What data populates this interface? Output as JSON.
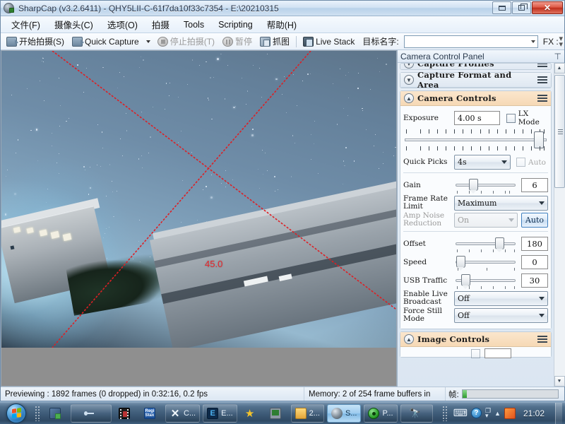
{
  "window": {
    "title": "SharpCap (v3.2.6411) - QHY5LII-C-61f7da10f33c7354 - E:\\20210315",
    "app_icon": "sharpcap-camera-icon",
    "buttons": {
      "minimize": "minimize-icon",
      "restore": "restore-icon",
      "close": "✕"
    }
  },
  "menubar": {
    "items": [
      {
        "label": "文件(F)",
        "name": "menu-file"
      },
      {
        "label": "摄像头(C)",
        "name": "menu-camera"
      },
      {
        "label": "选项(O)",
        "name": "menu-options"
      },
      {
        "label": "拍摄",
        "name": "menu-capture"
      },
      {
        "label": "Tools",
        "name": "menu-tools"
      },
      {
        "label": "Scripting",
        "name": "menu-scripting"
      },
      {
        "label": "帮助(H)",
        "name": "menu-help"
      }
    ]
  },
  "toolbar": {
    "start_capture": "开始拍摄(S)",
    "quick_capture": "Quick Capture",
    "stop_capture": "停止拍摄(T)",
    "pause": "暂停",
    "snapshot": "抓图",
    "live_stack": "Live Stack",
    "target_name_label": "目标名字:",
    "target_name_value": "",
    "target_name_placeholder": "",
    "fx_label": "FX :"
  },
  "preview": {
    "angle_overlay": "45.0",
    "overlay_color": "#e8252a",
    "description": "night-sky-camera-preview"
  },
  "camera_panel": {
    "title": "Camera Control Panel",
    "pin_icon": "pin-icon",
    "sections": [
      {
        "name": "capture-profiles",
        "title": "Capture Profiles",
        "expanded": false
      },
      {
        "name": "capture-format-and-area",
        "title": "Capture Format and Area",
        "expanded": false
      },
      {
        "name": "camera-controls",
        "title": "Camera Controls",
        "expanded": true
      },
      {
        "name": "image-controls",
        "title": "Image Controls",
        "expanded": true
      }
    ],
    "camera_controls": {
      "exposure": {
        "label": "Exposure",
        "value": "4.00 s",
        "lx_mode_label": "LX Mode",
        "lx_mode_checked": false
      },
      "quick_picks": {
        "label": "Quick Picks",
        "value": "4s",
        "auto_label": "Auto",
        "auto_checked": false
      },
      "gain": {
        "label": "Gain",
        "value": "6",
        "percent": 22
      },
      "frame_rate_limit": {
        "label": "Frame Rate Limit",
        "value": "Maximum"
      },
      "amp_noise_reduction": {
        "label": "Amp Noise Reduction",
        "value": "On",
        "auto_button": "Auto"
      },
      "offset": {
        "label": "Offset",
        "value": "180",
        "percent": 70
      },
      "speed": {
        "label": "Speed",
        "value": "0",
        "percent": 2
      },
      "usb_traffic": {
        "label": "USB Traffic",
        "value": "30",
        "percent": 12
      },
      "enable_live_broadcast": {
        "label": "Enable Live Broadcast",
        "value": "Off"
      },
      "force_still_mode": {
        "label": "Force Still Mode",
        "value": "Off"
      }
    }
  },
  "statusbar": {
    "frames": "Previewing : 1892 frames (0 dropped) in 0:32:16, 0.2 fps",
    "memory": "Memory: 2 of 254 frame buffers in",
    "progress_label": "帧:",
    "progress_percent": 5,
    "progress_color": "#2f9b2f"
  },
  "taskbar": {
    "start_label": "start-orb",
    "items": [
      {
        "name": "taskbar-item-explorer",
        "label": "",
        "icon": "green-folder-icon",
        "active": false
      },
      {
        "name": "taskbar-item-usb",
        "label": "",
        "icon": "usb-icon",
        "active": false
      },
      {
        "name": "taskbar-item-video",
        "label": "",
        "icon": "film-strip-icon",
        "active": false
      },
      {
        "name": "taskbar-item-registax",
        "label": "",
        "icon": "registax-icon",
        "active": false
      },
      {
        "name": "taskbar-item-c",
        "label": "C...",
        "icon": "x-close-icon",
        "active": false
      },
      {
        "name": "taskbar-item-e",
        "label": "E...",
        "icon": "blue-e-icon",
        "active": false
      },
      {
        "name": "taskbar-item-star",
        "label": "",
        "icon": "star-icon",
        "active": false
      },
      {
        "name": "taskbar-item-monitor",
        "label": "",
        "icon": "monitor-icon",
        "active": false
      },
      {
        "name": "taskbar-item-folder2",
        "label": "2...",
        "icon": "folder-icon",
        "active": false
      },
      {
        "name": "taskbar-item-sharpcap",
        "label": "S...",
        "icon": "sharpcap-icon",
        "active": true
      },
      {
        "name": "taskbar-item-p",
        "label": "P...",
        "icon": "green-circle-icon",
        "active": false
      },
      {
        "name": "taskbar-item-telescope",
        "label": "",
        "icon": "telescope-icon",
        "active": false
      }
    ],
    "tray": [
      {
        "name": "tray-keyboard-icon",
        "glyph": "⌨"
      },
      {
        "name": "tray-help-icon",
        "glyph": "?"
      },
      {
        "name": "tray-network-icon",
        "glyph": ""
      },
      {
        "name": "tray-show-hidden-icon",
        "glyph": "▲"
      },
      {
        "name": "tray-app-icon",
        "glyph": ""
      }
    ],
    "clock": "21:02"
  }
}
